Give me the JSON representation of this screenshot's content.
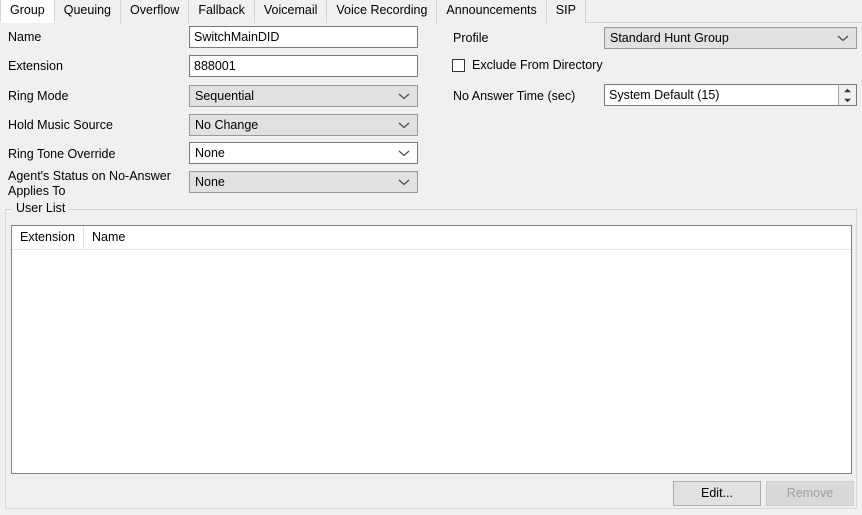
{
  "window": {
    "background": "#f0f0f0"
  },
  "tabs": {
    "active_index": 0,
    "items": [
      {
        "label": "Group"
      },
      {
        "label": "Queuing"
      },
      {
        "label": "Overflow"
      },
      {
        "label": "Fallback"
      },
      {
        "label": "Voicemail"
      },
      {
        "label": "Voice Recording"
      },
      {
        "label": "Announcements"
      },
      {
        "label": "SIP"
      }
    ]
  },
  "form": {
    "left": {
      "name": {
        "label": "Name",
        "value": "SwitchMainDID"
      },
      "extension": {
        "label": "Extension",
        "value": "888001"
      },
      "ring_mode": {
        "label": "Ring Mode",
        "value": "Sequential"
      },
      "hold_music_source": {
        "label": "Hold Music Source",
        "value": "No Change"
      },
      "ring_tone_override": {
        "label": "Ring Tone Override",
        "value": "None"
      },
      "agent_status": {
        "label": "Agent's Status on No-Answer\nApplies To",
        "value": "None"
      }
    },
    "right": {
      "profile": {
        "label": "Profile",
        "value": "Standard Hunt Group"
      },
      "exclude_from_directory": {
        "label": "Exclude From Directory",
        "checked": false
      },
      "no_answer_time": {
        "label": "No Answer Time (sec)",
        "value": "System Default (15)"
      }
    }
  },
  "user_list": {
    "legend": "User List",
    "columns": [
      {
        "label": "Extension",
        "width": 72
      },
      {
        "label": "Name",
        "width": 120
      }
    ],
    "rows": [],
    "buttons": {
      "edit": {
        "label": "Edit...",
        "enabled": true
      },
      "remove": {
        "label": "Remove",
        "enabled": false
      }
    }
  },
  "icons": {
    "chevron_down": "chevron-down-icon",
    "spinner_up": "spinner-up-arrow-icon",
    "spinner_down": "spinner-down-arrow-icon"
  }
}
